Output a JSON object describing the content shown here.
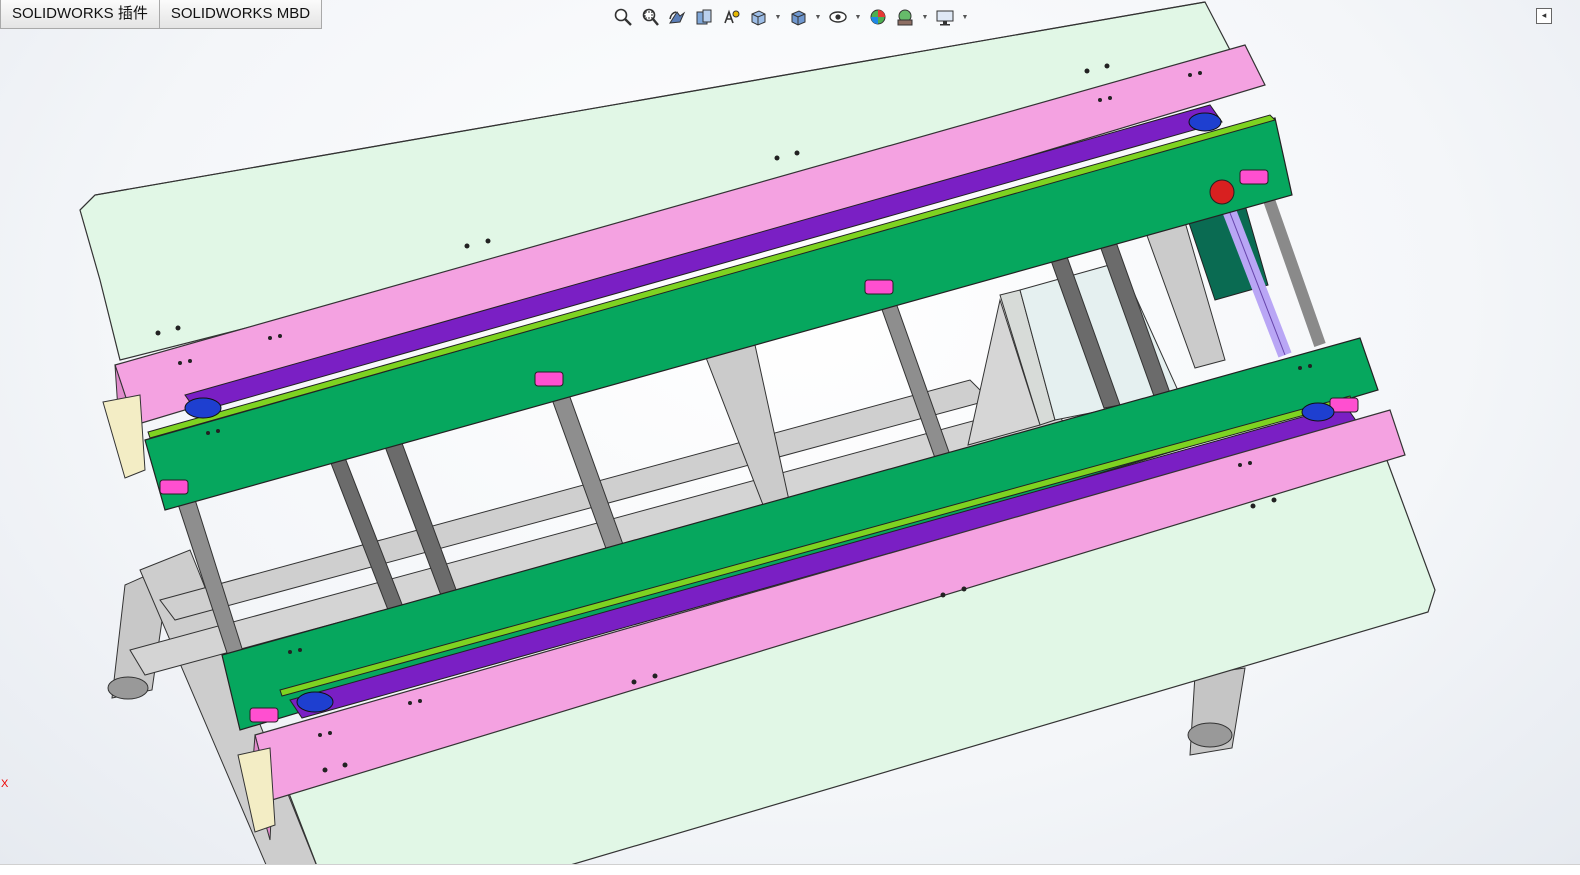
{
  "app": {
    "tabs": [
      {
        "label": "SOLIDWORKS 插件"
      },
      {
        "label": "SOLIDWORKS MBD"
      }
    ]
  },
  "heads_up_toolbar": {
    "buttons": [
      {
        "icon": "zoom-to-fit-icon",
        "has_dropdown": false
      },
      {
        "icon": "zoom-to-area-icon",
        "has_dropdown": false
      },
      {
        "icon": "previous-view-icon",
        "has_dropdown": false
      },
      {
        "icon": "section-view-icon",
        "has_dropdown": false
      },
      {
        "icon": "dynamic-annotation-icon",
        "has_dropdown": false
      },
      {
        "icon": "view-orientation-icon",
        "has_dropdown": true
      },
      {
        "icon": "display-style-icon",
        "has_dropdown": true
      },
      {
        "icon": "hide-show-items-icon",
        "has_dropdown": true
      },
      {
        "icon": "edit-appearance-icon",
        "has_dropdown": false
      },
      {
        "icon": "apply-scene-icon",
        "has_dropdown": true
      },
      {
        "icon": "view-settings-icon",
        "has_dropdown": true
      }
    ]
  },
  "triad": {
    "x_label": "X"
  },
  "colors": {
    "table_top": "#e1f7e6",
    "pink_rail": "#f4a2e1",
    "green_rail": "#06a75e",
    "purple_belt": "#7a1fc4",
    "lime_strip": "#7ed321",
    "frame_gray": "#c8c8c8",
    "roller_gray": "#6b6b6b",
    "magenta_bearing": "#ff4fd0",
    "motor": "#0a6b52"
  }
}
